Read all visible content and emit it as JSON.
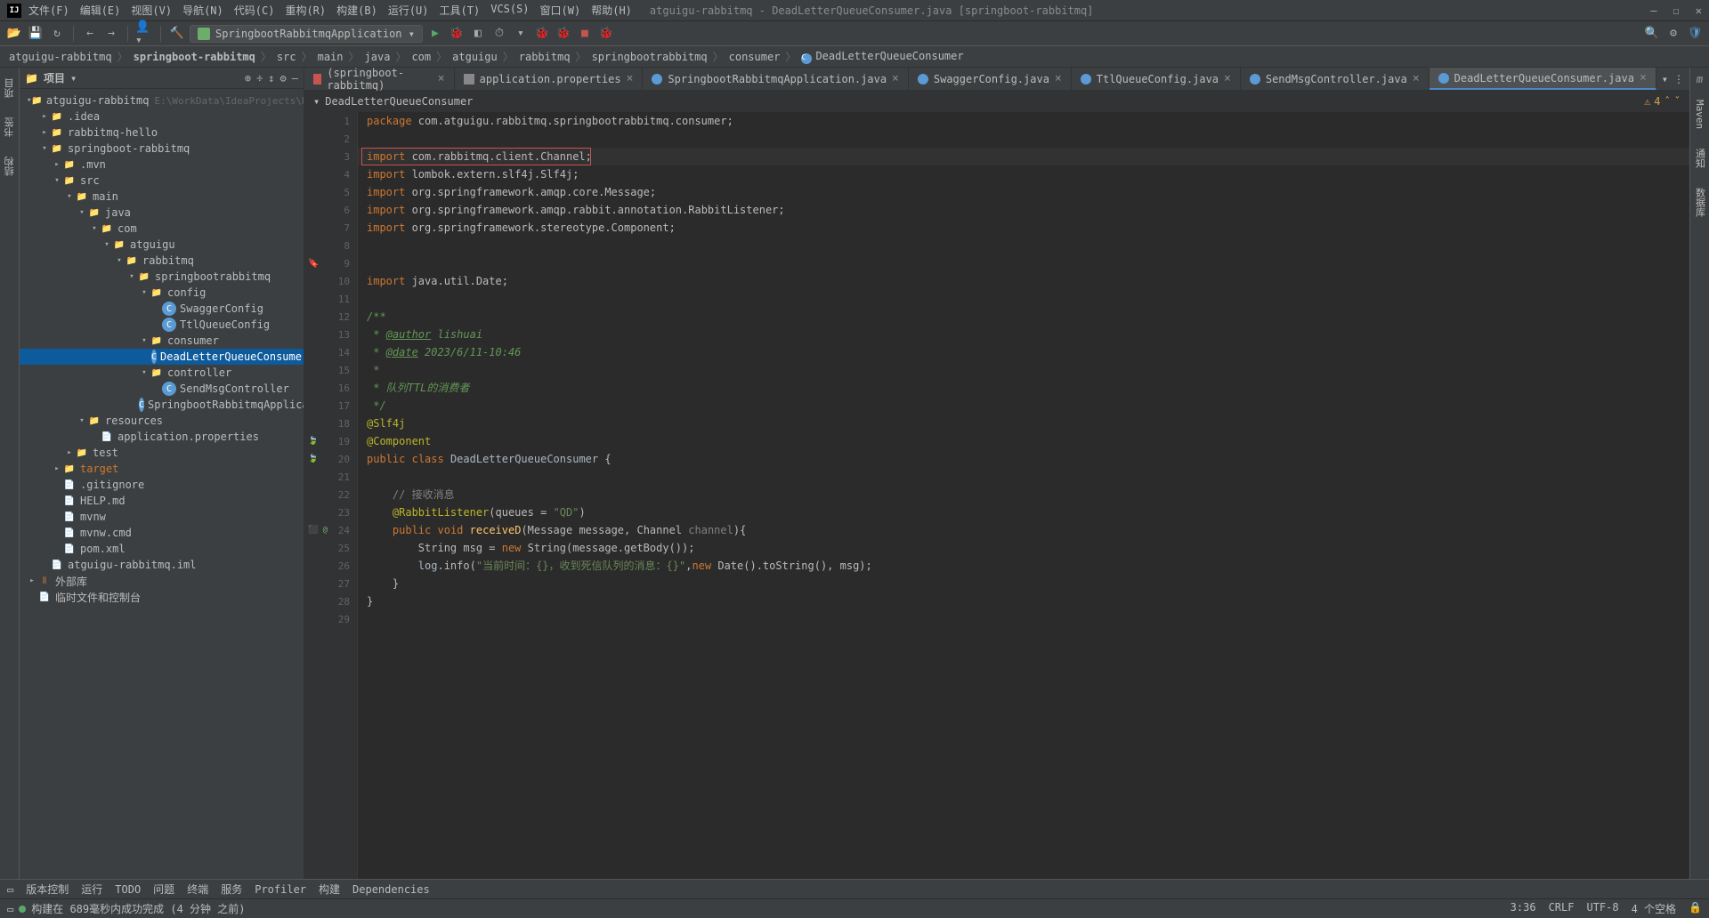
{
  "title": "atguigu-rabbitmq - DeadLetterQueueConsumer.java [springboot-rabbitmq]",
  "menus": [
    "文件(F)",
    "编辑(E)",
    "视图(V)",
    "导航(N)",
    "代码(C)",
    "重构(R)",
    "构建(B)",
    "运行(U)",
    "工具(T)",
    "VCS(S)",
    "窗口(W)",
    "帮助(H)"
  ],
  "run_config": "SpringbootRabbitmqApplication ▾",
  "breadcrumb": [
    "atguigu-rabbitmq",
    "springboot-rabbitmq",
    "src",
    "main",
    "java",
    "com",
    "atguigu",
    "rabbitmq",
    "springbootrabbitmq",
    "consumer",
    "DeadLetterQueueConsumer"
  ],
  "project_title": "项目",
  "tree": [
    {
      "d": 0,
      "a": "▾",
      "ico": "folder-open",
      "l": "atguigu-rabbitmq",
      "hint": "E:\\WorkData\\IdeaProjects\\RabbitMQ\\at"
    },
    {
      "d": 1,
      "a": "▸",
      "ico": "folder",
      "l": ".idea"
    },
    {
      "d": 1,
      "a": "▸",
      "ico": "folder-open",
      "l": "rabbitmq-hello"
    },
    {
      "d": 1,
      "a": "▾",
      "ico": "folder-open",
      "l": "springboot-rabbitmq"
    },
    {
      "d": 2,
      "a": "▸",
      "ico": "folder",
      "l": ".mvn"
    },
    {
      "d": 2,
      "a": "▾",
      "ico": "folder-open",
      "l": "src"
    },
    {
      "d": 3,
      "a": "▾",
      "ico": "folder-open",
      "l": "main"
    },
    {
      "d": 4,
      "a": "▾",
      "ico": "folder-open",
      "l": "java"
    },
    {
      "d": 5,
      "a": "▾",
      "ico": "folder-open",
      "l": "com"
    },
    {
      "d": 6,
      "a": "▾",
      "ico": "folder-open",
      "l": "atguigu"
    },
    {
      "d": 7,
      "a": "▾",
      "ico": "folder-open",
      "l": "rabbitmq"
    },
    {
      "d": 8,
      "a": "▾",
      "ico": "folder-open",
      "l": "springbootrabbitmq"
    },
    {
      "d": 9,
      "a": "▾",
      "ico": "folder-open",
      "l": "config"
    },
    {
      "d": 10,
      "a": "",
      "ico": "java",
      "l": "SwaggerConfig"
    },
    {
      "d": 10,
      "a": "",
      "ico": "java",
      "l": "TtlQueueConfig"
    },
    {
      "d": 9,
      "a": "▾",
      "ico": "folder-open",
      "l": "consumer"
    },
    {
      "d": 10,
      "a": "",
      "ico": "java",
      "l": "DeadLetterQueueConsumer",
      "sel": true
    },
    {
      "d": 9,
      "a": "▾",
      "ico": "folder-open",
      "l": "controller"
    },
    {
      "d": 10,
      "a": "",
      "ico": "java",
      "l": "SendMsgController"
    },
    {
      "d": 9,
      "a": "",
      "ico": "java",
      "l": "SpringbootRabbitmqApplication"
    },
    {
      "d": 4,
      "a": "▾",
      "ico": "folder-open",
      "l": "resources"
    },
    {
      "d": 5,
      "a": "",
      "ico": "file",
      "l": "application.properties"
    },
    {
      "d": 3,
      "a": "▸",
      "ico": "folder-open",
      "l": "test"
    },
    {
      "d": 2,
      "a": "▸",
      "ico": "folder",
      "l": "target",
      "orange": true
    },
    {
      "d": 2,
      "a": "",
      "ico": "file",
      "l": ".gitignore"
    },
    {
      "d": 2,
      "a": "",
      "ico": "file",
      "l": "HELP.md"
    },
    {
      "d": 2,
      "a": "",
      "ico": "file",
      "l": "mvnw"
    },
    {
      "d": 2,
      "a": "",
      "ico": "file",
      "l": "mvnw.cmd"
    },
    {
      "d": 2,
      "a": "",
      "ico": "file",
      "l": "pom.xml"
    },
    {
      "d": 1,
      "a": "",
      "ico": "file",
      "l": "atguigu-rabbitmq.iml"
    },
    {
      "d": 0,
      "a": "▸",
      "ico": "lib",
      "l": "外部库"
    },
    {
      "d": 0,
      "a": "",
      "ico": "file",
      "l": "临时文件和控制台"
    }
  ],
  "tabs": [
    {
      "l": "(springboot-rabbitmq)",
      "ico": "xml"
    },
    {
      "l": "application.properties",
      "ico": "prop"
    },
    {
      "l": "SpringbootRabbitmqApplication.java",
      "ico": "java"
    },
    {
      "l": "SwaggerConfig.java",
      "ico": "java"
    },
    {
      "l": "TtlQueueConfig.java",
      "ico": "java"
    },
    {
      "l": "SendMsgController.java",
      "ico": "java"
    },
    {
      "l": "DeadLetterQueueConsumer.java",
      "ico": "java",
      "active": true
    }
  ],
  "navbar_label": "DeadLetterQueueConsumer",
  "warn_count": "4",
  "code": [
    {
      "n": 1,
      "h": "<span class='kw'>package</span> com.atguigu.rabbitmq.springbootrabbitmq.consumer;"
    },
    {
      "n": 2,
      "h": ""
    },
    {
      "n": 3,
      "h": "<span class='kw'>import</span> com.rabbitmq.client.Channel;",
      "cur": true
    },
    {
      "n": 4,
      "h": "<span class='kw'>import</span> lombok.extern.slf4j.Slf4j;"
    },
    {
      "n": 5,
      "h": "<span class='kw'>import</span> org.springframework.amqp.core.Message;"
    },
    {
      "n": 6,
      "h": "<span class='kw'>import</span> org.springframework.amqp.rabbit.annotation.RabbitListener;"
    },
    {
      "n": 7,
      "h": "<span class='kw'>import</span> org.springframework.stereotype.Component;"
    },
    {
      "n": 8,
      "h": ""
    },
    {
      "n": 9,
      "h": "",
      "bm": true
    },
    {
      "n": 10,
      "h": "<span class='kw'>import</span> java.util.Date;"
    },
    {
      "n": 11,
      "h": ""
    },
    {
      "n": 12,
      "h": "<span class='doc'>/**</span>"
    },
    {
      "n": 13,
      "h": "<span class='doc'> * </span><span class='doctag'>@author</span><span class='doc'> lishuai</span>"
    },
    {
      "n": 14,
      "h": "<span class='doc'> * </span><span class='doctag'>@date</span><span class='doc'> 2023/6/11-10:46</span>"
    },
    {
      "n": 15,
      "h": "<span class='doc'> *</span>"
    },
    {
      "n": 16,
      "h": "<span class='doc'> * 队列TTL的消费者</span>"
    },
    {
      "n": 17,
      "h": "<span class='doc'> */</span>"
    },
    {
      "n": 18,
      "h": "<span class='ann'>@Slf4j</span>"
    },
    {
      "n": 19,
      "h": "<span class='ann'>@Component</span>",
      "gm": "🍃"
    },
    {
      "n": 20,
      "h": "<span class='kw'>public</span> <span class='kw'>class</span> <span class='cls'>DeadLetterQueueConsumer</span> {",
      "gm": "🍃"
    },
    {
      "n": 21,
      "h": ""
    },
    {
      "n": 22,
      "h": "    <span class='com'>// 接收消息</span>"
    },
    {
      "n": 23,
      "h": "    <span class='ann'>@RabbitListener</span>(queues = <span class='str'>\"QD\"</span>)"
    },
    {
      "n": 24,
      "h": "    <span class='kw'>public</span> <span class='kw'>void</span> <span class='fn'>receiveD</span>(Message message, Channel <span class='com'>channel</span>){",
      "gm": "⬛ @"
    },
    {
      "n": 25,
      "h": "        String msg = <span class='kw'>new</span> String(message.getBody());"
    },
    {
      "n": 26,
      "h": "        <span class='type'>log</span>.info(<span class='str'>\"当前时间：{}，收到死信队列的消息：{}\"</span>,<span class='kw'>new</span> Date().toString(), msg);"
    },
    {
      "n": 27,
      "h": "    }"
    },
    {
      "n": 28,
      "h": "}"
    },
    {
      "n": 29,
      "h": ""
    }
  ],
  "bottom_tools": [
    "版本控制",
    "运行",
    "TODO",
    "问题",
    "终端",
    "服务",
    "Profiler",
    "构建",
    "Dependencies"
  ],
  "status_build": "构建在 689毫秒内成功完成 (4 分钟 之前)",
  "status_right": [
    "3:36",
    "CRLF",
    "UTF-8",
    "4 个空格"
  ],
  "left_tabs": [
    "项目",
    "书签",
    "结构"
  ],
  "right_tabs": [
    "Maven",
    "通知",
    "数据库"
  ]
}
